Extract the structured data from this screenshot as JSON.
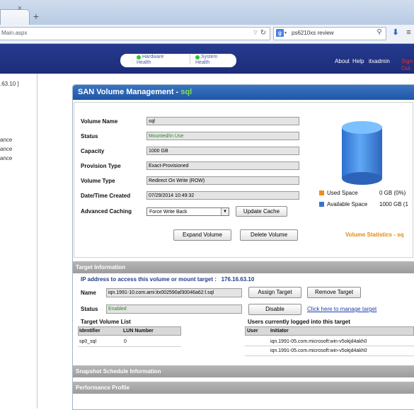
{
  "browser": {
    "tab_close": "×",
    "new_tab": "+",
    "url": "Main.aspx",
    "search_engine_icon": "g",
    "search_text": "ps6210xs review",
    "icons": [
      "close-icon",
      "new-tab-icon",
      "dropdown-icon",
      "reload-icon",
      "google-icon",
      "search-icon",
      "download-icon",
      "menu-icon"
    ]
  },
  "header": {
    "hardware_health": [
      "Hardware",
      "Health"
    ],
    "system_health": [
      "System",
      "Health"
    ],
    "about": "About",
    "help": "Help",
    "user": "itxadmin",
    "sign_out": "Sign Out",
    "sign_out_color": "#e03030",
    "status_dot_color": "#33c33a"
  },
  "left": {
    "ip_fragment": ".63.10 ]",
    "items": [
      "ance",
      "ance",
      "ance"
    ]
  },
  "panel": {
    "title": "SAN Volume Management - ",
    "title_volume": "sql",
    "fields": {
      "volume_name_label": "Volume Name",
      "volume_name": "sql",
      "status_label": "Status",
      "status": "Mounted/In Use",
      "capacity_label": "Capacity",
      "capacity": "1000 GB",
      "provision_label": "Provision Type",
      "provision": "Exact-Provisioned",
      "volume_type_label": "Volume Type",
      "volume_type": "Redirect On Write (ROW)",
      "created_label": "Date/Time Created",
      "created": "07/29/2014 10:49:32",
      "caching_label": "Advanced Caching",
      "caching": "Force Write Back"
    },
    "update_cache": "Update Cache",
    "expand_volume": "Expand Volume",
    "delete_volume": "Delete Volume",
    "volume_statistics": "Volume Statistics - ",
    "volume_statistics_name": "sq",
    "used_space_label": "Used Space",
    "used_space_value": "0 GB (0%)",
    "available_space_label": "Available Space",
    "available_space_value": "1000 GB (1",
    "used_color": "#f08a1c",
    "available_color": "#3a73c8"
  },
  "target": {
    "section_title": "Target Information",
    "ip_label": "IP address to access this volume or mount target :",
    "ip": "176.16.63.10",
    "name_label": "Name",
    "name": "iqn.1991-10.com.ami:itx002590af30046a62:l.sql",
    "assign_target": "Assign Target",
    "remove_target": "Remove Target",
    "status_label": "Status",
    "status": "Enabled",
    "disable": "Disable",
    "manage_link": "Click here to manage target",
    "list_title": "Target Volume List",
    "list_headers": [
      "Identifier",
      "LUN Number"
    ],
    "list_rows": [
      [
        "sp0_sql",
        "0"
      ]
    ],
    "users_title": "Users currently logged into this target",
    "users_headers": [
      "User",
      "Initiator"
    ],
    "users_rows": [
      [
        "",
        "iqn.1991-05.com.microsoft:win-v5okjd4akh0"
      ],
      [
        "",
        "iqn.1991-05.com.microsoft:win-v5okjd4akh0"
      ]
    ]
  },
  "sections": {
    "snapshot": "Snapshot Schedule Information",
    "performance": "Performance Profile"
  }
}
